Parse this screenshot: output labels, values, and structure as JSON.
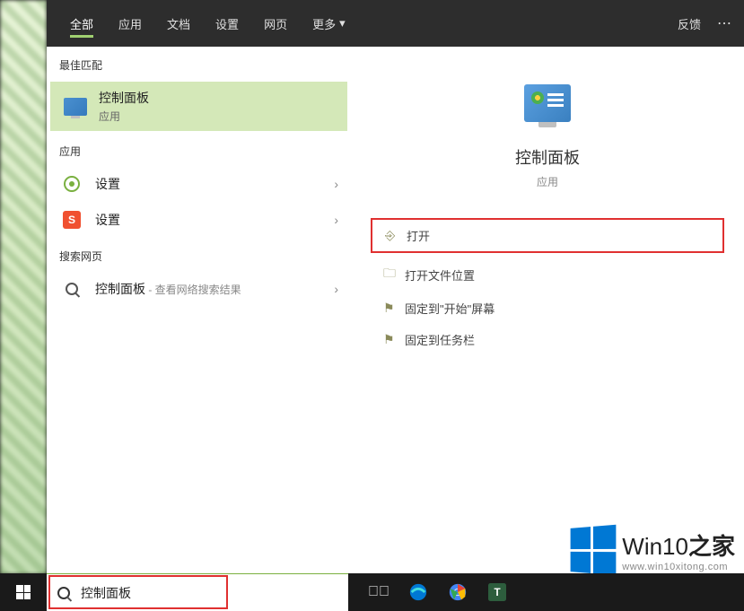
{
  "tabs": {
    "all": "全部",
    "apps": "应用",
    "docs": "文档",
    "settings": "设置",
    "web": "网页",
    "more": "更多"
  },
  "header": {
    "feedback": "反馈"
  },
  "sections": {
    "best_match": "最佳匹配",
    "apps": "应用",
    "search_web": "搜索网页"
  },
  "results": {
    "best": {
      "title": "控制面板",
      "sub": "应用"
    },
    "app1": {
      "title": "设置"
    },
    "app2": {
      "title": "设置",
      "icon_letter": "S"
    },
    "web": {
      "title": "控制面板",
      "suffix": " - 查看网络搜索结果"
    }
  },
  "detail": {
    "title": "控制面板",
    "sub": "应用",
    "actions": {
      "open": "打开",
      "open_location": "打开文件位置",
      "pin_start": "固定到\"开始\"屏幕",
      "pin_taskbar": "固定到任务栏"
    }
  },
  "search": {
    "value": "控制面板"
  },
  "watermark": {
    "brand_a": "Win10",
    "brand_b": "之家",
    "url": "www.win10xitong.com"
  }
}
